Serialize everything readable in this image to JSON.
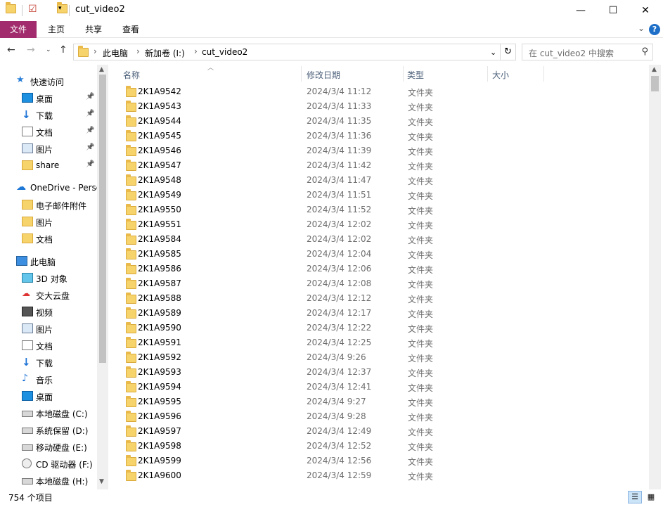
{
  "window": {
    "title": "cut_video2",
    "minimize": "—",
    "maximize": "☐",
    "close": "✕"
  },
  "ribbon": {
    "tabs": [
      "文件",
      "主页",
      "共享",
      "查看"
    ],
    "help": "?"
  },
  "address": {
    "crumbs": [
      "此电脑",
      "新加卷 (I:)",
      "cut_video2"
    ],
    "search_placeholder": "在 cut_video2 中搜索"
  },
  "sidebar": {
    "items": [
      {
        "label": "快速访问",
        "icon": "star-icon",
        "level": 0
      },
      {
        "label": "桌面",
        "icon": "desktop-icon",
        "level": 1,
        "pinned": true
      },
      {
        "label": "下载",
        "icon": "download-icon",
        "level": 1,
        "pinned": true
      },
      {
        "label": "文档",
        "icon": "document-icon",
        "level": 1,
        "pinned": true
      },
      {
        "label": "图片",
        "icon": "picture-icon",
        "level": 1,
        "pinned": true
      },
      {
        "label": "share",
        "icon": "folder-icon",
        "level": 1,
        "pinned": true
      },
      {
        "label": "OneDrive - Perso",
        "icon": "cloud-icon",
        "level": 0
      },
      {
        "label": "电子邮件附件",
        "icon": "folder-icon",
        "level": 1
      },
      {
        "label": "图片",
        "icon": "folder-icon",
        "level": 1
      },
      {
        "label": "文档",
        "icon": "folder-icon",
        "level": 1
      },
      {
        "label": "此电脑",
        "icon": "computer-icon",
        "level": 0
      },
      {
        "label": "3D 对象",
        "icon": "3d-objects-icon",
        "level": 1
      },
      {
        "label": "交大云盘",
        "icon": "cloud-drive-icon",
        "level": 1
      },
      {
        "label": "视频",
        "icon": "video-icon",
        "level": 1
      },
      {
        "label": "图片",
        "icon": "picture-icon",
        "level": 1
      },
      {
        "label": "文档",
        "icon": "document-icon",
        "level": 1
      },
      {
        "label": "下载",
        "icon": "download-icon",
        "level": 1
      },
      {
        "label": "音乐",
        "icon": "music-icon",
        "level": 1
      },
      {
        "label": "桌面",
        "icon": "desktop-icon",
        "level": 1
      },
      {
        "label": "本地磁盘 (C:)",
        "icon": "system-drive-icon",
        "level": 1
      },
      {
        "label": "系统保留 (D:)",
        "icon": "drive-icon",
        "level": 1
      },
      {
        "label": "移动硬盘 (E:)",
        "icon": "drive-icon",
        "level": 1
      },
      {
        "label": "CD 驱动器 (F:)",
        "icon": "cd-drive-icon",
        "level": 1
      },
      {
        "label": "本地磁盘 (H:)",
        "icon": "drive-icon",
        "level": 1
      }
    ]
  },
  "columns": {
    "name": "名称",
    "date": "修改日期",
    "type": "类型",
    "size": "大小"
  },
  "files": [
    {
      "name": "2K1A9542",
      "date": "2024/3/4 11:12",
      "type": "文件夹"
    },
    {
      "name": "2K1A9543",
      "date": "2024/3/4 11:33",
      "type": "文件夹"
    },
    {
      "name": "2K1A9544",
      "date": "2024/3/4 11:35",
      "type": "文件夹"
    },
    {
      "name": "2K1A9545",
      "date": "2024/3/4 11:36",
      "type": "文件夹"
    },
    {
      "name": "2K1A9546",
      "date": "2024/3/4 11:39",
      "type": "文件夹"
    },
    {
      "name": "2K1A9547",
      "date": "2024/3/4 11:42",
      "type": "文件夹"
    },
    {
      "name": "2K1A9548",
      "date": "2024/3/4 11:47",
      "type": "文件夹"
    },
    {
      "name": "2K1A9549",
      "date": "2024/3/4 11:51",
      "type": "文件夹"
    },
    {
      "name": "2K1A9550",
      "date": "2024/3/4 11:52",
      "type": "文件夹"
    },
    {
      "name": "2K1A9551",
      "date": "2024/3/4 12:02",
      "type": "文件夹"
    },
    {
      "name": "2K1A9584",
      "date": "2024/3/4 12:02",
      "type": "文件夹"
    },
    {
      "name": "2K1A9585",
      "date": "2024/3/4 12:04",
      "type": "文件夹"
    },
    {
      "name": "2K1A9586",
      "date": "2024/3/4 12:06",
      "type": "文件夹"
    },
    {
      "name": "2K1A9587",
      "date": "2024/3/4 12:08",
      "type": "文件夹"
    },
    {
      "name": "2K1A9588",
      "date": "2024/3/4 12:12",
      "type": "文件夹"
    },
    {
      "name": "2K1A9589",
      "date": "2024/3/4 12:17",
      "type": "文件夹"
    },
    {
      "name": "2K1A9590",
      "date": "2024/3/4 12:22",
      "type": "文件夹"
    },
    {
      "name": "2K1A9591",
      "date": "2024/3/4 12:25",
      "type": "文件夹"
    },
    {
      "name": "2K1A9592",
      "date": "2024/3/4 9:26",
      "type": "文件夹"
    },
    {
      "name": "2K1A9593",
      "date": "2024/3/4 12:37",
      "type": "文件夹"
    },
    {
      "name": "2K1A9594",
      "date": "2024/3/4 12:41",
      "type": "文件夹"
    },
    {
      "name": "2K1A9595",
      "date": "2024/3/4 9:27",
      "type": "文件夹"
    },
    {
      "name": "2K1A9596",
      "date": "2024/3/4 9:28",
      "type": "文件夹"
    },
    {
      "name": "2K1A9597",
      "date": "2024/3/4 12:49",
      "type": "文件夹"
    },
    {
      "name": "2K1A9598",
      "date": "2024/3/4 12:52",
      "type": "文件夹"
    },
    {
      "name": "2K1A9599",
      "date": "2024/3/4 12:56",
      "type": "文件夹"
    },
    {
      "name": "2K1A9600",
      "date": "2024/3/4 12:59",
      "type": "文件夹"
    }
  ],
  "status": {
    "count": "754 个项目"
  }
}
